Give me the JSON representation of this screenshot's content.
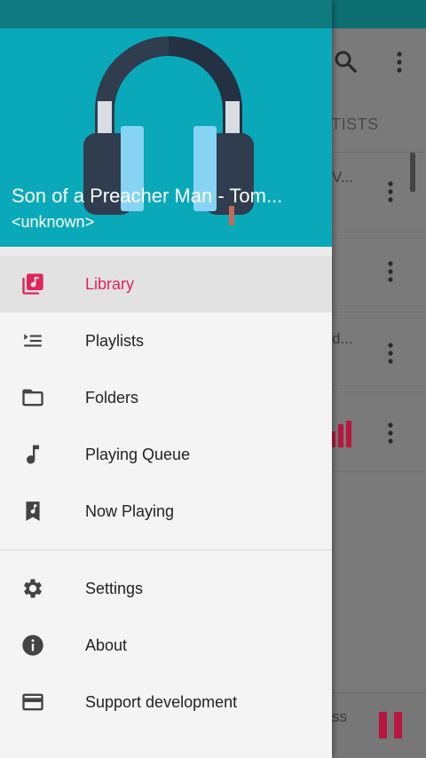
{
  "background_app": {
    "tab_label": "RTISTS",
    "rows": [
      {
        "text": "V..."
      },
      {
        "text": ""
      },
      {
        "text": "d..."
      },
      {
        "text": ""
      }
    ],
    "bottom_text": "ss"
  },
  "drawer": {
    "header": {
      "song_title": "Son of a Preacher Man - Tom...",
      "artist": "<unknown>"
    },
    "items": [
      {
        "label": "Library",
        "icon": "library-music-icon",
        "active": true
      },
      {
        "label": "Playlists",
        "icon": "playlist-icon",
        "active": false
      },
      {
        "label": "Folders",
        "icon": "folder-icon",
        "active": false
      },
      {
        "label": "Playing Queue",
        "icon": "music-note-icon",
        "active": false
      },
      {
        "label": "Now Playing",
        "icon": "now-playing-icon",
        "active": false
      }
    ],
    "secondary_items": [
      {
        "label": "Settings",
        "icon": "gear-icon"
      },
      {
        "label": "About",
        "icon": "info-icon"
      },
      {
        "label": "Support development",
        "icon": "credit-card-icon"
      }
    ]
  },
  "colors": {
    "accent": "#e0245e",
    "header_bg": "#0aa9ba",
    "statusbar": "#0f7a80"
  }
}
